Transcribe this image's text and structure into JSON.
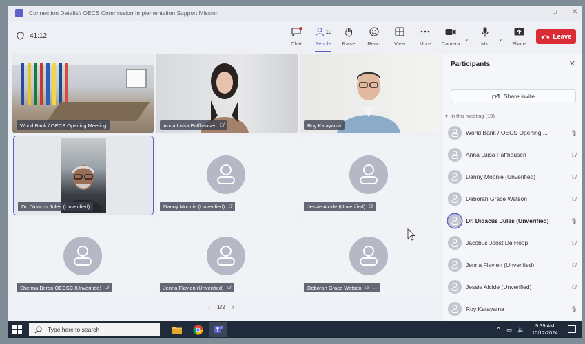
{
  "window": {
    "title": "Connection Details// OECS Commission Implementation Support Mission",
    "controls": [
      "···",
      "—",
      "□",
      "✕"
    ]
  },
  "toolbar": {
    "timer": "41:12",
    "chat_label": "Chat",
    "people_label": "People",
    "people_count": "10",
    "raise_label": "Raise",
    "react_label": "React",
    "view_label": "View",
    "more_label": "More",
    "camera_label": "Camera",
    "mic_label": "Mic",
    "share_label": "Share",
    "leave_label": "Leave"
  },
  "tiles": [
    {
      "name": "World Bank / OECS Opening Meeting",
      "muted": false
    },
    {
      "name": "Anna Luisa Paffhausen",
      "muted": true
    },
    {
      "name": "Roy Katayama",
      "muted": false
    },
    {
      "name": "Dr. Didacus Jules (Unverified)",
      "muted": false,
      "selected": true
    },
    {
      "name": "Danny Moonie (Unverified)",
      "muted": true
    },
    {
      "name": "Jessie Alcide (Unverified)",
      "muted": true
    },
    {
      "name": "Sherma Beroo OECSC (Unverified)",
      "muted": true
    },
    {
      "name": "Jenna Flavien (Unverified)",
      "muted": true
    },
    {
      "name": "Deborah Grace Watson",
      "muted": true,
      "more": "···"
    }
  ],
  "pager": {
    "label": "1/2",
    "prev": "‹",
    "next": "›"
  },
  "participants": {
    "title": "Participants",
    "share_invite": "Share invite",
    "section_label": "In this meeting (10)",
    "list": [
      {
        "name": "World Bank / OECS Opening ...",
        "muted": false
      },
      {
        "name": "Anna Luisa Paffhausen",
        "muted": true
      },
      {
        "name": "Danny Moonie (Unverified)",
        "muted": true
      },
      {
        "name": "Deborah Grace Watson",
        "muted": true
      },
      {
        "name": "Dr. Didacus Jules (Unverified)",
        "muted": false,
        "speaking": true
      },
      {
        "name": "Jacobus Joost De Hoop",
        "muted": true
      },
      {
        "name": "Jenna Flavien (Unverified)",
        "muted": true
      },
      {
        "name": "Jessie Alcide (Unverified)",
        "muted": true
      },
      {
        "name": "Roy Katayama",
        "muted": false
      }
    ]
  },
  "taskbar": {
    "search_placeholder": "Type here to search",
    "time": "9:39 AM",
    "date": "10/12/2024"
  },
  "colors": {
    "accent": "#5b5fc7",
    "leave": "#d92c34",
    "taskbar": "#1f2a3a"
  }
}
